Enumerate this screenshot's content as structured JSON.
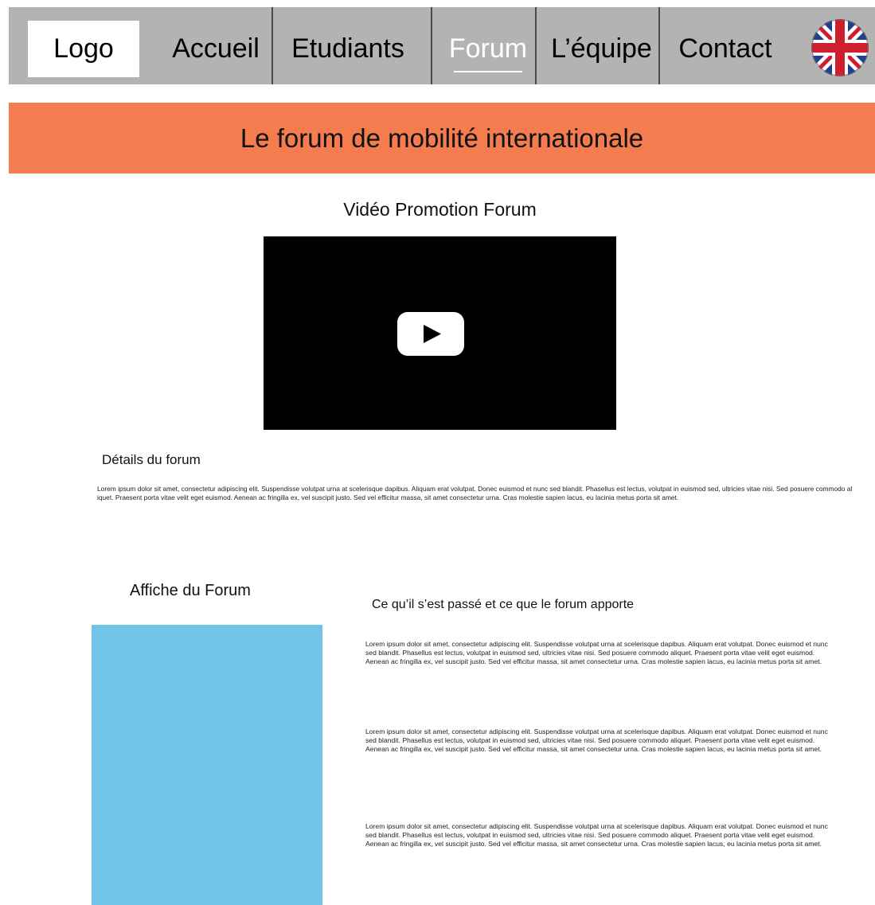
{
  "nav": {
    "logo": "Logo",
    "items": [
      "Accueil",
      "Etudiants",
      "Forum",
      "L’équipe",
      "Contact"
    ],
    "active": "Forum",
    "language_icon": "uk-flag-icon"
  },
  "banner": {
    "title": "Le forum de mobilité internationale"
  },
  "video": {
    "title": "Vidéo Promotion Forum",
    "play_icon": "play-icon"
  },
  "details": {
    "title": "Détails du forum",
    "text": "Lorem ipsum dolor sit amet, consectetur adipiscing elit. Suspendisse volutpat urna at scelerisque dapibus. Aliquam erat volutpat. Donec euismod et nunc sed blandit. Phasellus est lectus, volutpat in euismod sed, ultricies vitae nisi. Sed posuere commodo aliquet. Praesent porta vitae velit eget euismod. Aenean ac fringilla ex, vel suscipit justo. Sed vel efficitur massa, sit amet consectetur urna. Cras molestie sapien lacus, eu lacinia metus porta sit amet."
  },
  "poster": {
    "title": "Affiche du Forum",
    "color": "#70c4e8"
  },
  "right": {
    "title": "Ce qu’il s’est passé et ce que le forum apporte",
    "paragraphs": [
      "Lorem ipsum dolor sit amet, consectetur adipiscing elit. Suspendisse volutpat urna at scelerisque dapibus. Aliquam erat volutpat. Donec euismod et nunc sed blandit. Phasellus est lectus, volutpat in euismod sed, ultricies vitae nisi. Sed posuere commodo aliquet. Praesent porta vitae velit eget euismod. Aenean ac fringilla ex, vel suscipit justo. Sed vel efficitur massa, sit amet consectetur urna. Cras molestie sapien lacus, eu lacinia metus porta sit amet.",
      "Lorem ipsum dolor sit amet, consectetur adipiscing elit. Suspendisse volutpat urna at scelerisque dapibus. Aliquam erat volutpat. Donec euismod et nunc sed blandit. Phasellus est lectus, volutpat in euismod sed, ultricies vitae nisi. Sed posuere commodo aliquet. Praesent porta vitae velit eget euismod. Aenean ac fringilla ex, vel suscipit justo. Sed vel efficitur massa, sit amet consectetur urna. Cras molestie sapien lacus, eu lacinia metus porta sit amet.",
      "Lorem ipsum dolor sit amet, consectetur adipiscing elit. Suspendisse volutpat urna at scelerisque dapibus. Aliquam erat volutpat. Donec euismod et nunc sed blandit. Phasellus est lectus, volutpat in euismod sed, ultricies vitae nisi. Sed posuere commodo aliquet. Praesent porta vitae velit eget euismod. Aenean ac fringilla ex, vel suscipit justo. Sed vel efficitur massa, sit amet consectetur urna. Cras molestie sapien lacus, eu lacinia metus porta sit amet."
    ]
  },
  "colors": {
    "nav_bg": "#b3b3b3",
    "banner": "#f47c4f",
    "poster": "#70c4e8"
  }
}
